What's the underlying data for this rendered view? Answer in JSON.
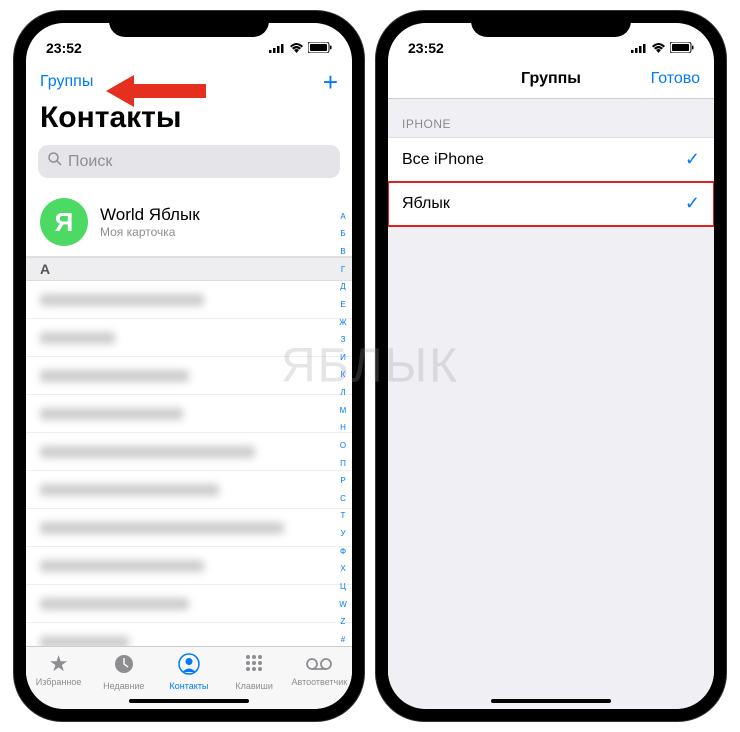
{
  "status": {
    "time": "23:52"
  },
  "left_screen": {
    "nav": {
      "groups": "Группы",
      "add": "+"
    },
    "title": "Контакты",
    "search_placeholder": "Поиск",
    "mycard": {
      "initial": "Я",
      "name": "World Яблык",
      "sub": "Моя карточка"
    },
    "section": "A",
    "index": [
      "А",
      "Б",
      "В",
      "Г",
      "Д",
      "Е",
      "Ж",
      "З",
      "И",
      "К",
      "Л",
      "М",
      "Н",
      "О",
      "П",
      "Р",
      "С",
      "Т",
      "У",
      "Ф",
      "Х",
      "Ц",
      "W",
      "Z",
      "#"
    ],
    "tabs": {
      "favorites": "Избранное",
      "recents": "Недавние",
      "contacts": "Контакты",
      "keypad": "Клавиши",
      "voicemail": "Автоответчик"
    }
  },
  "right_screen": {
    "nav": {
      "title": "Группы",
      "done": "Готово"
    },
    "section": "IPHONE",
    "rows": [
      {
        "label": "Все iPhone",
        "checked": true
      },
      {
        "label": "Яблык",
        "checked": true,
        "highlight": true
      }
    ]
  },
  "watermark": "ЯБЛЫК"
}
